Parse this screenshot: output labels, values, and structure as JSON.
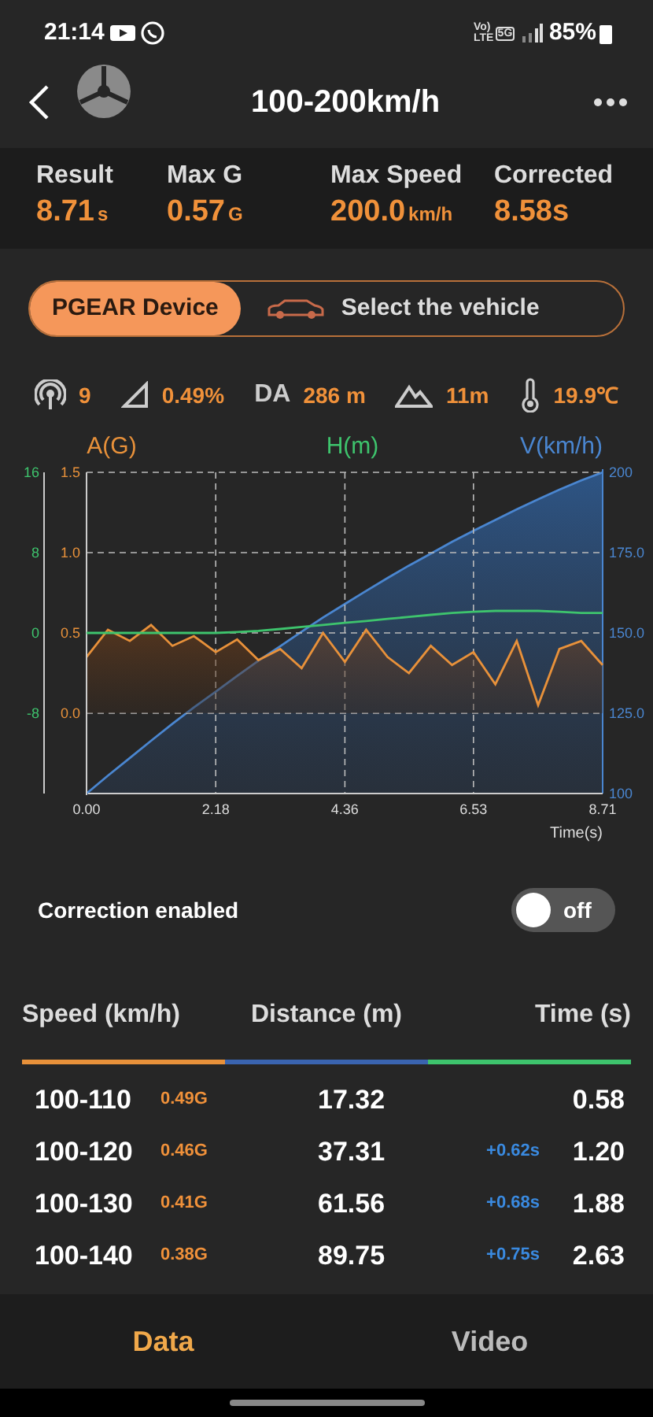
{
  "status_bar": {
    "time": "21:14",
    "network_labels": [
      "Vo) LTE",
      "5G"
    ],
    "battery": "85%"
  },
  "header": {
    "title": "100-200km/h"
  },
  "summary": [
    {
      "label": "Result",
      "value": "8.71",
      "unit": "s"
    },
    {
      "label": "Max G",
      "value": "0.57",
      "unit": "G"
    },
    {
      "label": "Max Speed",
      "value": "200.0",
      "unit": "km/h"
    },
    {
      "label": "Corrected",
      "value": "8.58s"
    }
  ],
  "source_switch": [
    {
      "label": "PGEAR Device",
      "selected": true
    },
    {
      "label": "Select the vehicle",
      "selected": false
    }
  ],
  "conditions": [
    {
      "kind": "satellites",
      "value": "9"
    },
    {
      "kind": "slope",
      "value": "0.49%"
    },
    {
      "kind": "density_altitude",
      "label": "DA",
      "value": "286 m"
    },
    {
      "kind": "altitude",
      "value": "11m"
    },
    {
      "kind": "temperature",
      "value": "19.9℃"
    }
  ],
  "chart": {
    "layers": [
      {
        "chart_data": {
          "type": "area",
          "grid": true,
          "xlabel": "Time(s)",
          "xlim": [
            0,
            8.71
          ],
          "ylim": [
            -0.5,
            1.5
          ],
          "xticks": [
            {
              "value": 0,
              "label": "0.00"
            },
            {
              "value": 2.18,
              "label": "2.18"
            },
            {
              "value": 4.36,
              "label": "4.36"
            },
            {
              "value": 6.53,
              "label": "6.53"
            },
            {
              "value": 8.71,
              "label": "8.71"
            }
          ],
          "yticks": [
            {
              "value": 1.5,
              "label": "1.5"
            },
            {
              "value": 1,
              "label": "1.0"
            },
            {
              "value": 0.5,
              "label": "0.5"
            },
            {
              "value": 0,
              "label": "0.0"
            }
          ],
          "x": [
            0,
            0.36,
            0.73,
            1.09,
            1.45,
            1.81,
            2.18,
            2.54,
            2.9,
            3.27,
            3.63,
            3.99,
            4.36,
            4.72,
            5.08,
            5.44,
            5.81,
            6.17,
            6.53,
            6.9,
            7.26,
            7.62,
            7.98,
            8.35,
            8.71
          ],
          "series": [
            {
              "name": "A(G)",
              "color": "#e8913a",
              "values": [
                0.35,
                0.52,
                0.45,
                0.55,
                0.42,
                0.48,
                0.38,
                0.46,
                0.33,
                0.4,
                0.28,
                0.5,
                0.32,
                0.52,
                0.35,
                0.25,
                0.42,
                0.3,
                0.38,
                0.18,
                0.45,
                0.05,
                0.4,
                0.45,
                0.3
              ]
            }
          ]
        }
      },
      {
        "chart_data": {
          "type": "line",
          "xlim": [
            0,
            8.71
          ],
          "ylim": [
            -16,
            16
          ],
          "yticks": [
            16,
            8,
            0,
            -8
          ],
          "x": [
            0,
            0.36,
            0.73,
            1.09,
            1.45,
            1.81,
            2.18,
            2.54,
            2.9,
            3.27,
            3.63,
            3.99,
            4.36,
            4.72,
            5.08,
            5.44,
            5.81,
            6.17,
            6.53,
            6.9,
            7.26,
            7.62,
            7.98,
            8.35,
            8.71
          ],
          "series": [
            {
              "name": "H(m)",
              "color": "#3ec46d",
              "values": [
                0,
                0,
                0,
                0,
                0,
                0,
                0,
                0.1,
                0.2,
                0.4,
                0.6,
                0.8,
                1,
                1.2,
                1.4,
                1.6,
                1.8,
                2,
                2.1,
                2.2,
                2.2,
                2.2,
                2.1,
                2,
                2
              ]
            }
          ]
        }
      },
      {
        "chart_data": {
          "type": "area",
          "xlim": [
            0,
            8.71
          ],
          "ylim": [
            100,
            200
          ],
          "yticks": [
            200,
            {
              "value": 175,
              "label": "175.0"
            },
            {
              "value": 150,
              "label": "150.0"
            },
            {
              "value": 125,
              "label": "125.0"
            },
            100
          ],
          "x": [
            0,
            0.36,
            0.73,
            1.09,
            1.45,
            1.81,
            2.18,
            2.54,
            2.9,
            3.27,
            3.63,
            3.99,
            4.36,
            4.72,
            5.08,
            5.44,
            5.81,
            6.17,
            6.53,
            6.9,
            7.26,
            7.62,
            7.98,
            8.35,
            8.71
          ],
          "series": [
            {
              "name": "V(km/h)",
              "color": "#4a86d0",
              "values": [
                100,
                105.6,
                111.1,
                116.4,
                121.7,
                126.8,
                131.7,
                136.6,
                141.3,
                145.9,
                150.4,
                154.8,
                159,
                163.1,
                167.1,
                171,
                174.7,
                178.4,
                181.8,
                185.2,
                188.5,
                191.6,
                194.6,
                197.5,
                200
              ]
            }
          ]
        }
      }
    ]
  },
  "correction": {
    "label": "Correction enabled",
    "on": false,
    "toggle_text": "off"
  },
  "splits": {
    "columns": [
      {
        "title": "Speed (km/h)",
        "color": "#e8913a"
      },
      {
        "title": "Distance (m)",
        "color": "#3a64b0"
      },
      {
        "title": "Time (s)",
        "color": "#3ec46d"
      }
    ],
    "rows": [
      {
        "speed": "100-110",
        "g": "0.49G",
        "distance": "17.32",
        "time": "0.58"
      },
      {
        "speed": "100-120",
        "g": "0.46G",
        "distance": "37.31",
        "delta": "+0.62s",
        "time": "1.20"
      },
      {
        "speed": "100-130",
        "g": "0.41G",
        "distance": "61.56",
        "delta": "+0.68s",
        "time": "1.88"
      },
      {
        "speed": "100-140",
        "g": "0.38G",
        "distance": "89.75",
        "delta": "+0.75s",
        "time": "2.63"
      }
    ]
  },
  "bottom_tabs": [
    {
      "label": "Data",
      "selected": true
    },
    {
      "label": "Video",
      "selected": false
    }
  ]
}
